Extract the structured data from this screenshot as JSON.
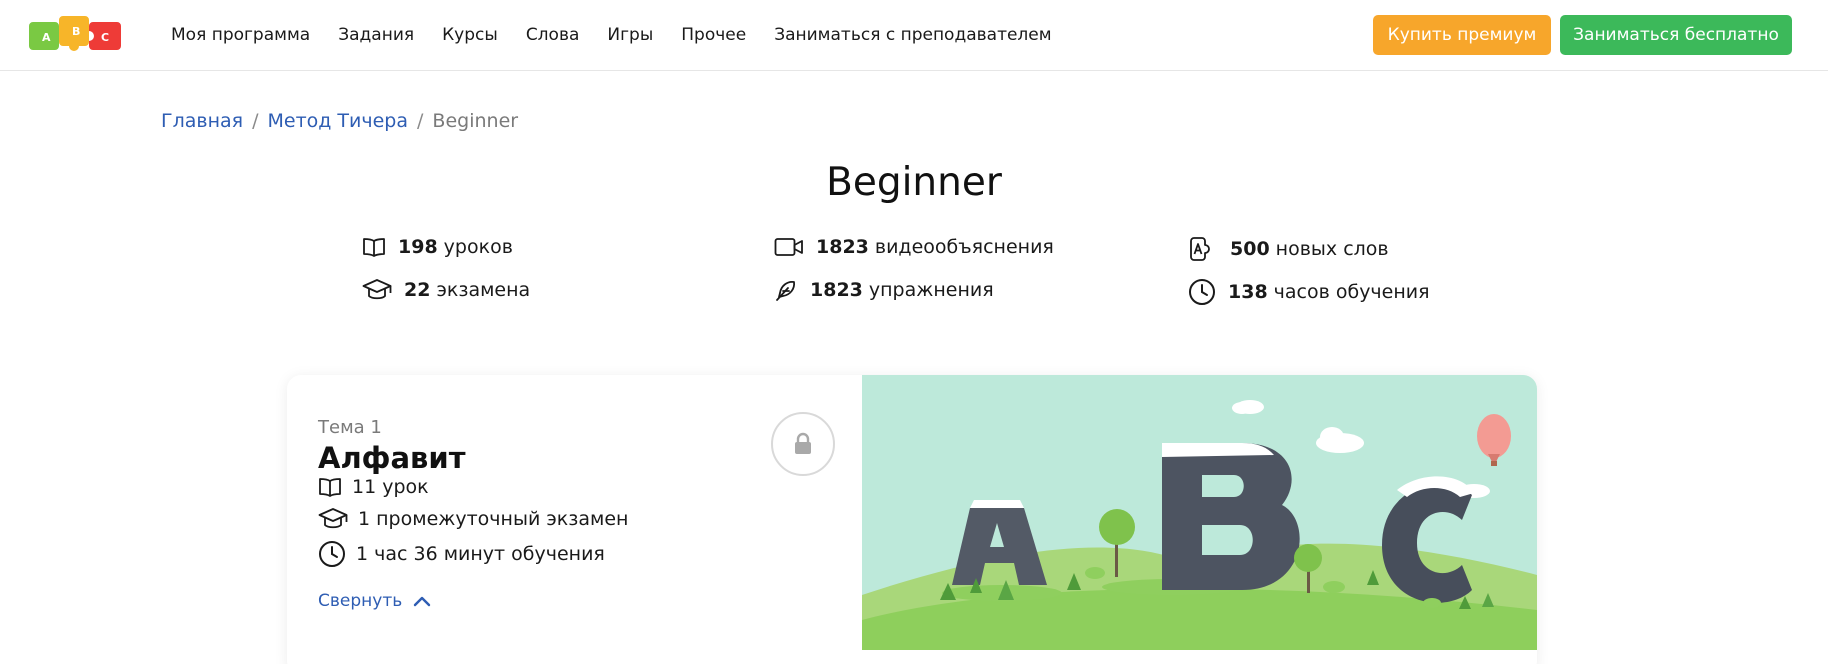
{
  "logo": {
    "letters": [
      "A",
      "B",
      "C"
    ]
  },
  "nav": {
    "items": [
      {
        "label": "Моя программа"
      },
      {
        "label": "Задания"
      },
      {
        "label": "Курсы"
      },
      {
        "label": "Слова"
      },
      {
        "label": "Игры"
      },
      {
        "label": "Прочее"
      },
      {
        "label": "Заниматься с преподавателем"
      }
    ]
  },
  "header": {
    "premium_label": "Купить премиум",
    "free_label": "Заниматься бесплатно"
  },
  "breadcrumb": {
    "home": "Главная",
    "method": "Метод Тичера",
    "current": "Beginner",
    "separator": "/"
  },
  "page": {
    "title": "Beginner"
  },
  "stats": {
    "lessons": {
      "value": "198",
      "label": "уроков",
      "icon": "book-icon"
    },
    "videos": {
      "value": "1823",
      "label": "видеообъяснения",
      "icon": "video-icon"
    },
    "words": {
      "value": "500",
      "label": "новых слов",
      "icon": "dictionary-icon"
    },
    "exams": {
      "value": "22",
      "label": "экзамена",
      "icon": "graduation-cap-icon"
    },
    "exercises": {
      "value": "1823",
      "label": "упражнения",
      "icon": "feather-icon"
    },
    "hours": {
      "value": "138",
      "label": "часов обучения",
      "icon": "clock-icon"
    }
  },
  "topic": {
    "theme": "Тема 1",
    "title": "Алфавит",
    "lessons": "11 урок",
    "exam": "1 промежуточный экзамен",
    "duration": "1 час 36 минут обучения",
    "collapse_label": "Свернуть",
    "locked_icon": "lock-icon"
  },
  "colors": {
    "accent_blue": "#2e5db3",
    "premium_orange": "#f7a62b",
    "free_green": "#3cb95a"
  }
}
